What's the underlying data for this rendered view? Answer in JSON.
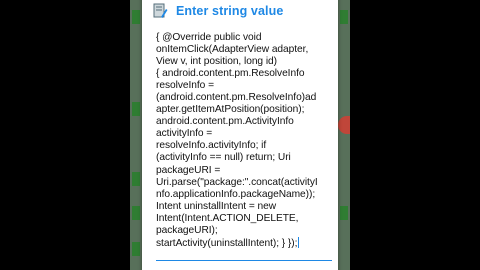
{
  "dialog": {
    "title": "Enter string value",
    "icon": "edit-document-icon",
    "title_color": "#1e88e5",
    "lines": [
      "{ @Override public void",
      "onItemClick(AdapterView adapter,",
      "View v, int position, long id)",
      "{ android.content.pm.ResolveInfo",
      "resolveInfo =",
      "(android.content.pm.ResolveInfo)ad",
      "apter.getItemAtPosition(position);",
      "android.content.pm.ActivityInfo",
      "activityInfo =",
      "resolveInfo.activityInfo; if",
      "(activityInfo == null) return; Uri",
      "packageURI =",
      "Uri.parse(\"package:\".concat(activityI",
      "nfo.applicationInfo.packageName));",
      "Intent uninstallIntent = new",
      "Intent(Intent.ACTION_DELETE,",
      "packageURI);",
      "startActivity(uninstallIntent); } });"
    ]
  }
}
